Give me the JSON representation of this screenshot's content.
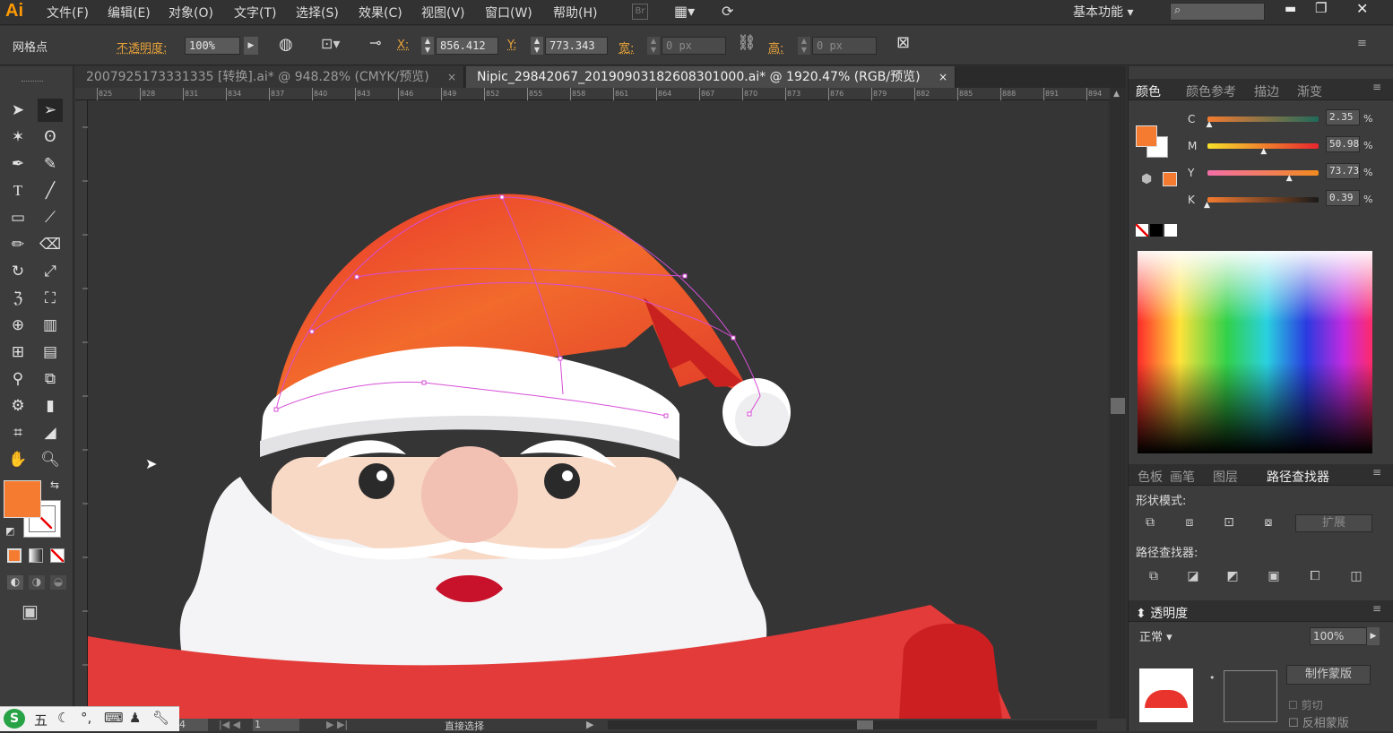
{
  "app": {
    "logo": "Ai"
  },
  "menu": [
    "文件(F)",
    "编辑(E)",
    "对象(O)",
    "文字(T)",
    "选择(S)",
    "效果(C)",
    "视图(V)",
    "窗口(W)",
    "帮助(H)"
  ],
  "workspace": {
    "label": "基本功能"
  },
  "control": {
    "selection_label": "网格点",
    "opacity_label": "不透明度:",
    "opacity_value": "100%",
    "x_label": "X:",
    "x_value": "856.412",
    "y_label": "Y:",
    "y_value": "773.343",
    "w_label": "宽:",
    "w_value": "0 px",
    "h_label": "高:",
    "h_value": "0 px"
  },
  "tabs": [
    {
      "label": "2007925173331335 [转换].ai* @ 948.28% (CMYK/预览)",
      "close": "×"
    },
    {
      "label": "Nipic_29842067_20190903182608301000.ai* @ 1920.47% (RGB/预览)",
      "close": "×"
    }
  ],
  "ruler": {
    "ticks": [
      "825",
      "828",
      "831",
      "834",
      "837",
      "840",
      "843",
      "846",
      "849",
      "852",
      "855",
      "858",
      "861",
      "864",
      "867",
      "870",
      "873",
      "876",
      "879",
      "882",
      "885",
      "888",
      "891",
      "894"
    ]
  },
  "color_panel": {
    "tabs": [
      "颜色",
      "颜色参考",
      "描边",
      "渐变"
    ],
    "channels": [
      {
        "label": "C",
        "value": "2.35",
        "unit": "%",
        "level": 0.02
      },
      {
        "label": "M",
        "value": "50.98",
        "unit": "%",
        "level": 0.51
      },
      {
        "label": "Y",
        "value": "73.73",
        "unit": "%",
        "level": 0.74
      },
      {
        "label": "K",
        "value": "0.39",
        "unit": "%",
        "level": 0.0
      }
    ],
    "fill_color": "#f47b30"
  },
  "pathfinder": {
    "tabs": [
      "色板",
      "画笔",
      "图层",
      "路径查找器"
    ],
    "shape_modes_label": "形状模式:",
    "expand_label": "扩展",
    "pathfinders_label": "路径查找器:"
  },
  "transparency": {
    "tab_label": "透明度",
    "opacity_value": "100%",
    "make_mask_label": "制作蒙版",
    "clip_label": "剪切",
    "invert_label": "反相蒙版"
  },
  "status": {
    "zoom": "4",
    "page": "1",
    "tool_name": "直接选择"
  },
  "ime": {
    "label": "五"
  },
  "colors": {
    "accent": "#f47b30",
    "hat_red": "#e8342c",
    "path_magenta": "#d64fd6"
  }
}
